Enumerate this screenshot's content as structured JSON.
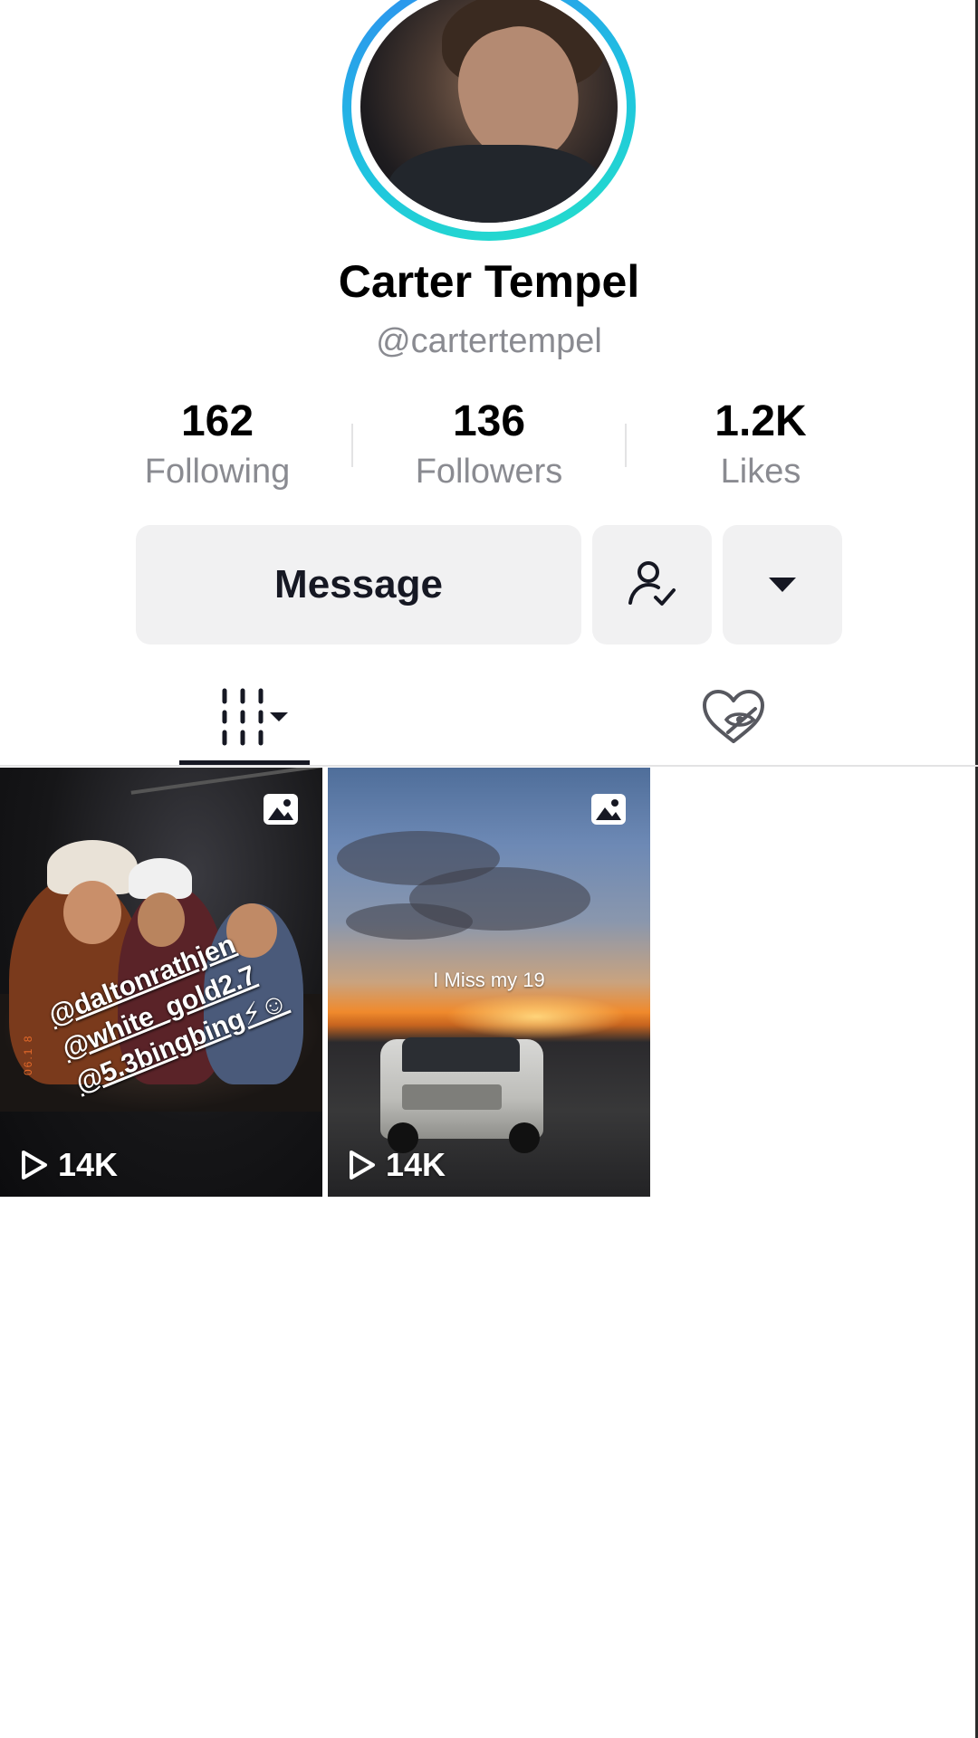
{
  "profile": {
    "name": "Carter Tempel",
    "handle": "@cartertempel"
  },
  "stats": [
    {
      "value": "162",
      "label": "Following"
    },
    {
      "value": "136",
      "label": "Followers"
    },
    {
      "value": "1.2K",
      "label": "Likes"
    }
  ],
  "actions": {
    "message_label": "Message"
  },
  "tabs": {
    "videos_icon": "grid-icon",
    "liked_icon": "hidden-liked-icon"
  },
  "videos": [
    {
      "type": "photo",
      "views": "14K",
      "overlay_lines": [
        "@daltonrathjen",
        "@white_gold2.7",
        "@5.3bingbing⚡☺"
      ],
      "date_stamp": "06.1 8"
    },
    {
      "type": "photo",
      "views": "14K",
      "caption": "I Miss my 19"
    }
  ],
  "colors": {
    "avatar_ring_start": "#2f8bf0",
    "avatar_ring_end": "#25e0c8",
    "button_bg": "#f1f1f2",
    "secondary_text": "#8a8b91"
  }
}
